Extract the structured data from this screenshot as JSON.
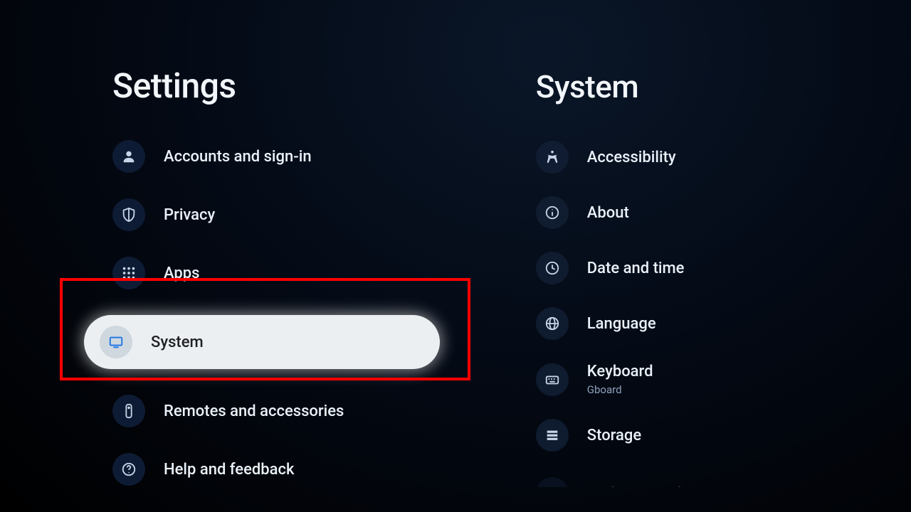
{
  "left": {
    "title": "Settings",
    "items": [
      {
        "label": "Accounts and sign-in",
        "icon": "account"
      },
      {
        "label": "Privacy",
        "icon": "shield"
      },
      {
        "label": "Apps",
        "icon": "apps-grid"
      },
      {
        "label": "System",
        "icon": "tv",
        "focused": true
      },
      {
        "label": "Remotes and accessories",
        "icon": "remote"
      },
      {
        "label": "Help and feedback",
        "icon": "help"
      }
    ]
  },
  "right": {
    "title": "System",
    "items": [
      {
        "label": "Accessibility",
        "icon": "accessibility"
      },
      {
        "label": "About",
        "icon": "info"
      },
      {
        "label": "Date and time",
        "icon": "clock"
      },
      {
        "label": "Language",
        "icon": "globe"
      },
      {
        "label": "Keyboard",
        "icon": "keyboard",
        "sub": "Gboard"
      },
      {
        "label": "Storage",
        "icon": "storage"
      },
      {
        "label": "Ambient mode",
        "icon": "ambient",
        "cut": true
      }
    ]
  },
  "annotation": {
    "highlight_item": "System",
    "box_color": "#ff0000"
  }
}
